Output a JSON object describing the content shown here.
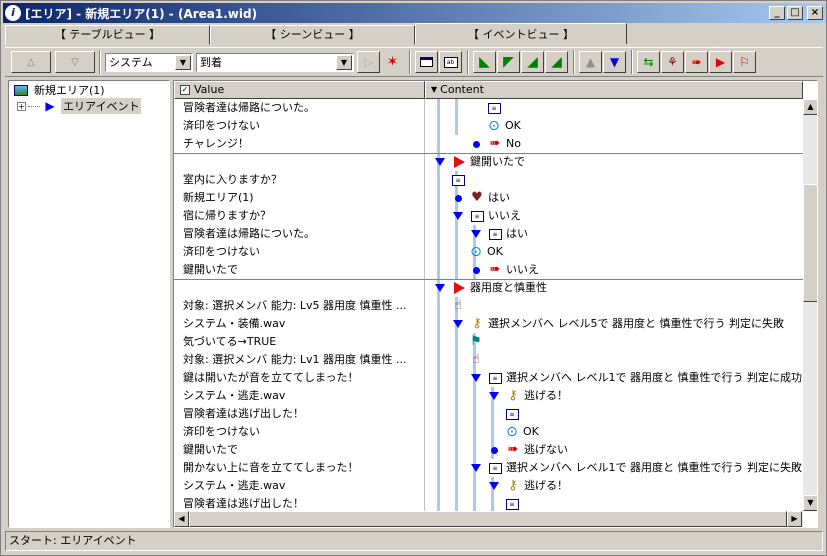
{
  "window": {
    "title": "[エリア] - 新規エリア(1) - (Area1.wid)",
    "min_label": "_",
    "max_label": "□",
    "close_label": "×"
  },
  "tabs": [
    {
      "label": "【 テーブルビュー 】"
    },
    {
      "label": "【 シーンビュー 】"
    },
    {
      "label": "【 イベントビュー 】"
    }
  ],
  "toolbar": {
    "up_label": "△",
    "down_label": "▽",
    "category_value": "システム",
    "sound_value": "到着"
  },
  "tree": {
    "root_label": "新規エリア(1)",
    "child_label": "エリアイベント",
    "expand_glyph": "+"
  },
  "grid": {
    "col_value": "Value",
    "col_content": "Content"
  },
  "rows": [
    {
      "value": "冒険者達は帰路についた。",
      "content": "",
      "icon": "card",
      "indent": 3
    },
    {
      "value": "済印をつけない",
      "content": "OK",
      "icon": "ok",
      "indent": 3
    },
    {
      "value": "チャレンジ！",
      "content": "No",
      "icon": "dotarrow",
      "indent": 2
    },
    {
      "value": "",
      "content": "鍵開いたで",
      "icon": "triflag",
      "indent": 0
    },
    {
      "value": "室内に入りますか？",
      "content": "",
      "icon": "card",
      "indent": 1
    },
    {
      "value": "新規エリア(1)",
      "content": "はい",
      "icon": "dotheart",
      "indent": 1
    },
    {
      "value": "宿に帰りますか？",
      "content": "いいえ",
      "icon": "tricard",
      "indent": 1
    },
    {
      "value": "冒険者達は帰路についた。",
      "content": "はい",
      "icon": "tricard",
      "indent": 2
    },
    {
      "value": "済印をつけない",
      "content": "OK",
      "icon": "ok",
      "indent": 2
    },
    {
      "value": "鍵開いたで",
      "content": "いいえ",
      "icon": "dotarrow",
      "indent": 2
    },
    {
      "value": "",
      "content": "器用度と慎重性",
      "icon": "triflag",
      "indent": 0
    },
    {
      "value": "対象: 選択メンバ 能力: Lv5 器用度 慎重性 ...",
      "content": "",
      "icon": "hand",
      "indent": 1
    },
    {
      "value": "システム・装備.wav",
      "content": "選択メンバへ レベル5で 器用度と 慎重性で行う 判定に失敗",
      "icon": "trikey",
      "indent": 1
    },
    {
      "value": "気づいてる→TRUE",
      "content": "",
      "icon": "greenflag",
      "indent": 2
    },
    {
      "value": "対象: 選択メンバ 能力: Lv1 器用度 慎重性 ...",
      "content": "",
      "icon": "hand",
      "indent": 2
    },
    {
      "value": "鍵は開いたが音を立ててしまった！",
      "content": "選択メンバへ レベル1で 器用度と 慎重性で行う 判定に成功",
      "icon": "tricard",
      "indent": 2
    },
    {
      "value": "システム・逃走.wav",
      "content": "逃げる！",
      "icon": "trikey",
      "indent": 3
    },
    {
      "value": "冒険者達は逃げ出した！",
      "content": "",
      "icon": "card",
      "indent": 4
    },
    {
      "value": "済印をつけない",
      "content": "OK",
      "icon": "ok",
      "indent": 4
    },
    {
      "value": "鍵開いたで",
      "content": "逃げない",
      "icon": "dotarrow",
      "indent": 3
    },
    {
      "value": "開かない上に音を立ててしまった！",
      "content": "選択メンバへ レベル1で 器用度と 慎重性で行う 判定に失敗",
      "icon": "tricard",
      "indent": 2
    },
    {
      "value": "システム・逃走.wav",
      "content": "逃げる！",
      "icon": "trikey",
      "indent": 3
    },
    {
      "value": "冒険者達は逃げ出した！",
      "content": "",
      "icon": "card",
      "indent": 4
    }
  ],
  "status": {
    "text": "スタート: エリアイベント"
  }
}
